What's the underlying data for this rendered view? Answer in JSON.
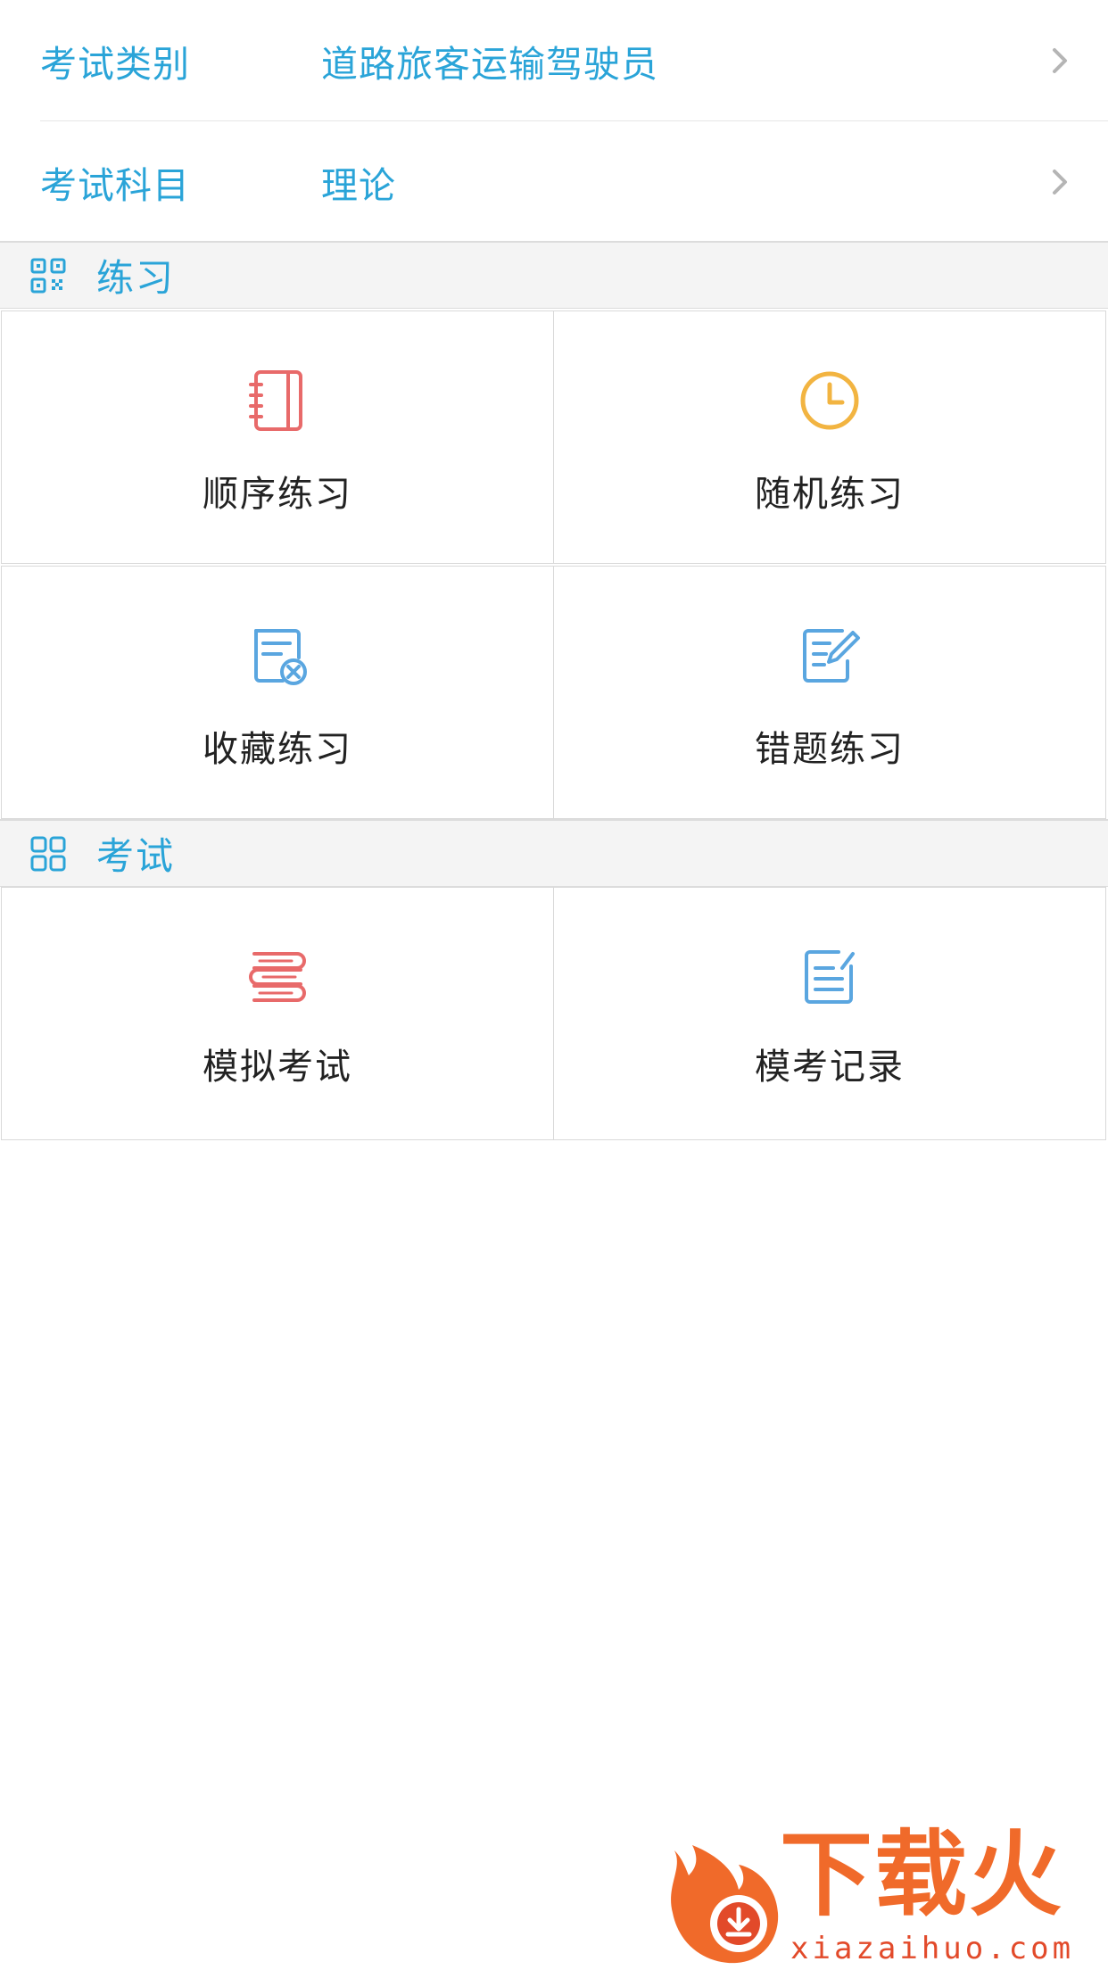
{
  "settings": {
    "exam_category": {
      "label": "考试类别",
      "value": "道路旅客运输驾驶员"
    },
    "exam_subject": {
      "label": "考试科目",
      "value": "理论"
    }
  },
  "practice": {
    "title": "练习",
    "items": [
      {
        "label": "顺序练习",
        "icon": "notebook-icon"
      },
      {
        "label": "随机练习",
        "icon": "clock-icon"
      },
      {
        "label": "收藏练习",
        "icon": "favorites-document-icon"
      },
      {
        "label": "错题练习",
        "icon": "edit-document-icon"
      }
    ]
  },
  "exam": {
    "title": "考试",
    "items": [
      {
        "label": "模拟考试",
        "icon": "stacked-books-icon"
      },
      {
        "label": "模考记录",
        "icon": "record-document-icon"
      }
    ]
  },
  "watermark": {
    "brand": "下载火",
    "domain": "xiazaihuo.com"
  },
  "colors": {
    "accent": "#2aa4d8",
    "red_icon": "#e86a6a",
    "orange_icon": "#f2b441",
    "blue_icon": "#5aa6e0"
  }
}
